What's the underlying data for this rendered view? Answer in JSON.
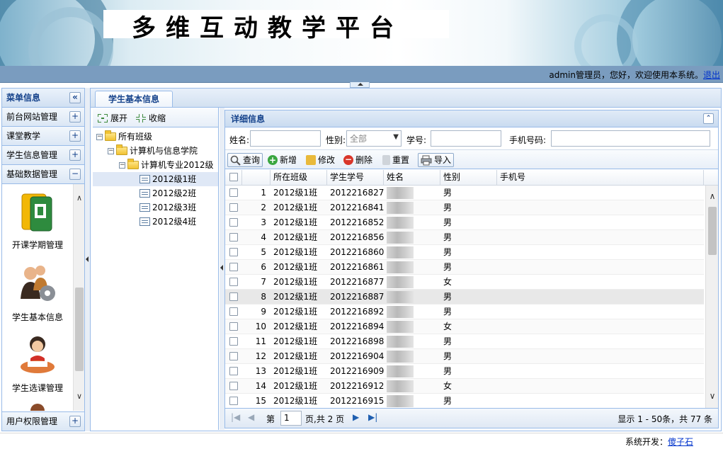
{
  "banner": {
    "title": "多维互动教学平台"
  },
  "userbar": {
    "welcome": "admin管理员，您好，欢迎使用本系统。",
    "logout": "退出"
  },
  "leftmenu": {
    "title": "菜单信息",
    "collapse_glyph": "«",
    "sections": [
      {
        "label": "前台网站管理",
        "glyph": "+"
      },
      {
        "label": "课堂教学",
        "glyph": "+"
      },
      {
        "label": "学生信息管理",
        "glyph": "+"
      },
      {
        "label": "基础数据管理",
        "glyph": "−"
      }
    ],
    "icons": [
      {
        "label": "开课学期管理",
        "icon": "semester-book-icon"
      },
      {
        "label": "学生基本信息",
        "icon": "students-gear-icon"
      },
      {
        "label": "学生选课管理",
        "icon": "student-reading-icon"
      }
    ],
    "bottom_section": {
      "label": "用户权限管理",
      "glyph": "+"
    }
  },
  "tabs": [
    {
      "label": "学生基本信息",
      "active": true
    }
  ],
  "tree": {
    "expand_label": "展开",
    "collapse_label": "收缩",
    "nodes": [
      {
        "label": "所有班级"
      },
      {
        "label": "计算机与信息学院"
      },
      {
        "label": "计算机专业2012级"
      },
      {
        "label": "2012级1班"
      },
      {
        "label": "2012级2班"
      },
      {
        "label": "2012级3班"
      },
      {
        "label": "2012级4班"
      }
    ]
  },
  "detail": {
    "title": "详细信息",
    "search": {
      "name_label": "姓名:",
      "gender_label": "性别:",
      "gender_value": "全部",
      "student_no_label": "学号:",
      "phone_label": "手机号码:"
    },
    "toolbar": {
      "query": "查询",
      "add": "新增",
      "edit": "修改",
      "delete": "删除",
      "reset": "重置",
      "import": "导入"
    },
    "columns": [
      "所在班级",
      "学生学号",
      "姓名",
      "性别",
      "手机号"
    ],
    "rows": [
      {
        "n": "1",
        "cls": "2012级1班",
        "no": "2012216827",
        "gender": "男"
      },
      {
        "n": "2",
        "cls": "2012级1班",
        "no": "2012216841",
        "gender": "男"
      },
      {
        "n": "3",
        "cls": "2012级1班",
        "no": "2012216852",
        "gender": "男"
      },
      {
        "n": "4",
        "cls": "2012级1班",
        "no": "2012216856",
        "gender": "男"
      },
      {
        "n": "5",
        "cls": "2012级1班",
        "no": "2012216860",
        "gender": "男"
      },
      {
        "n": "6",
        "cls": "2012级1班",
        "no": "2012216861",
        "gender": "男"
      },
      {
        "n": "7",
        "cls": "2012级1班",
        "no": "2012216877",
        "gender": "女"
      },
      {
        "n": "8",
        "cls": "2012级1班",
        "no": "2012216887",
        "gender": "男"
      },
      {
        "n": "9",
        "cls": "2012级1班",
        "no": "2012216892",
        "gender": "男"
      },
      {
        "n": "10",
        "cls": "2012级1班",
        "no": "2012216894",
        "gender": "女"
      },
      {
        "n": "11",
        "cls": "2012级1班",
        "no": "2012216898",
        "gender": "男"
      },
      {
        "n": "12",
        "cls": "2012级1班",
        "no": "2012216904",
        "gender": "男"
      },
      {
        "n": "13",
        "cls": "2012级1班",
        "no": "2012216909",
        "gender": "男"
      },
      {
        "n": "14",
        "cls": "2012级1班",
        "no": "2012216912",
        "gender": "女"
      },
      {
        "n": "15",
        "cls": "2012级1班",
        "no": "2012216915",
        "gender": "男"
      }
    ],
    "pager": {
      "page_prefix": "第",
      "page_value": "1",
      "page_suffix": "页,共 2 页",
      "summary": "显示 1 - 50条，共 77 条"
    }
  },
  "footer": {
    "label": "系统开发：",
    "author": "傻子石"
  },
  "colors": {
    "panel_border": "#99bbe8",
    "header_text": "#15428b",
    "userbar_bg": "#7a9cbf",
    "link": "#0033cc"
  }
}
